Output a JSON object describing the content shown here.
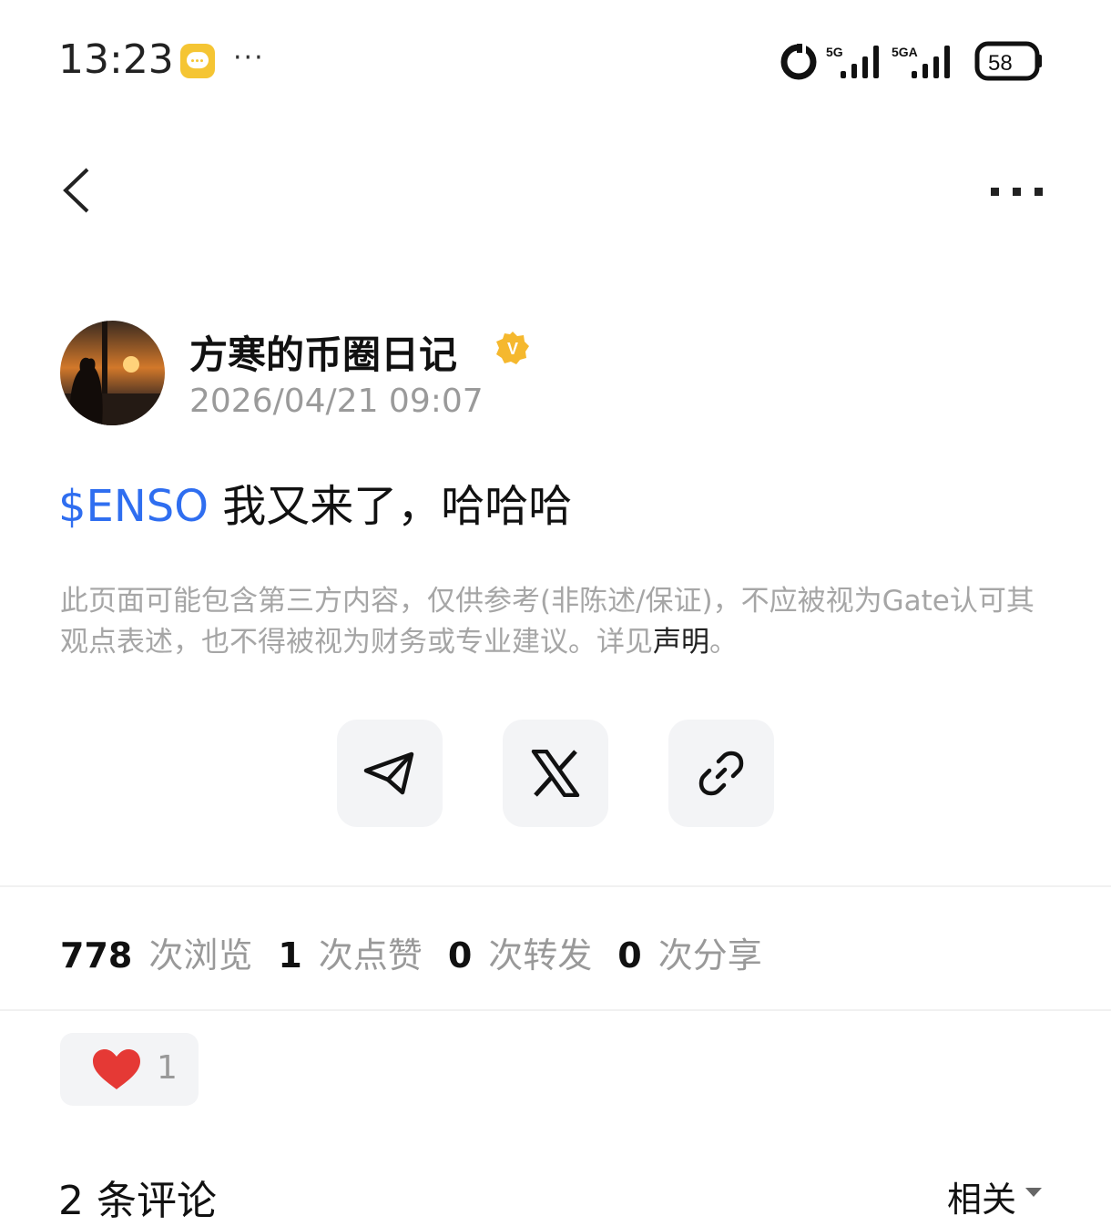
{
  "status_bar": {
    "time": "13:23",
    "more": "···",
    "net1": "5G",
    "net2": "5GA",
    "battery": "58",
    "icons": [
      "chat-icon",
      "ring-icon",
      "signal-icon",
      "battery-icon"
    ]
  },
  "nav": {
    "back_icon": "chevron-left-icon",
    "more_icon": "more-icon"
  },
  "author": {
    "name": "方寒的币圈日记",
    "verified_badge": "V",
    "posted_at": "2026/04/21 09:07"
  },
  "post": {
    "ticker": "$ENSO",
    "text": " 我又来了，哈哈哈"
  },
  "disclaimer": {
    "text": "此页面可能包含第三方内容，仅供参考(非陈述/保证)，不应被视为Gate认可其观点表述，也不得被视为财务或专业建议。详见",
    "link": "声明",
    "end": "。"
  },
  "share": {
    "buttons": [
      "telegram-icon",
      "x-icon",
      "link-icon"
    ]
  },
  "stats": {
    "views": "778",
    "views_label": "次浏览",
    "likes": "1",
    "likes_label": "次点赞",
    "reposts": "0",
    "reposts_label": "次转发",
    "shares": "0",
    "shares_label": "次分享"
  },
  "reaction": {
    "icon": "heart-icon",
    "count": "1",
    "color": "#e53935"
  },
  "comments": {
    "title": "2 条评论",
    "sort": "相关"
  },
  "colors": {
    "accent": "#2f6ef0",
    "badge": "#f5b82e"
  }
}
